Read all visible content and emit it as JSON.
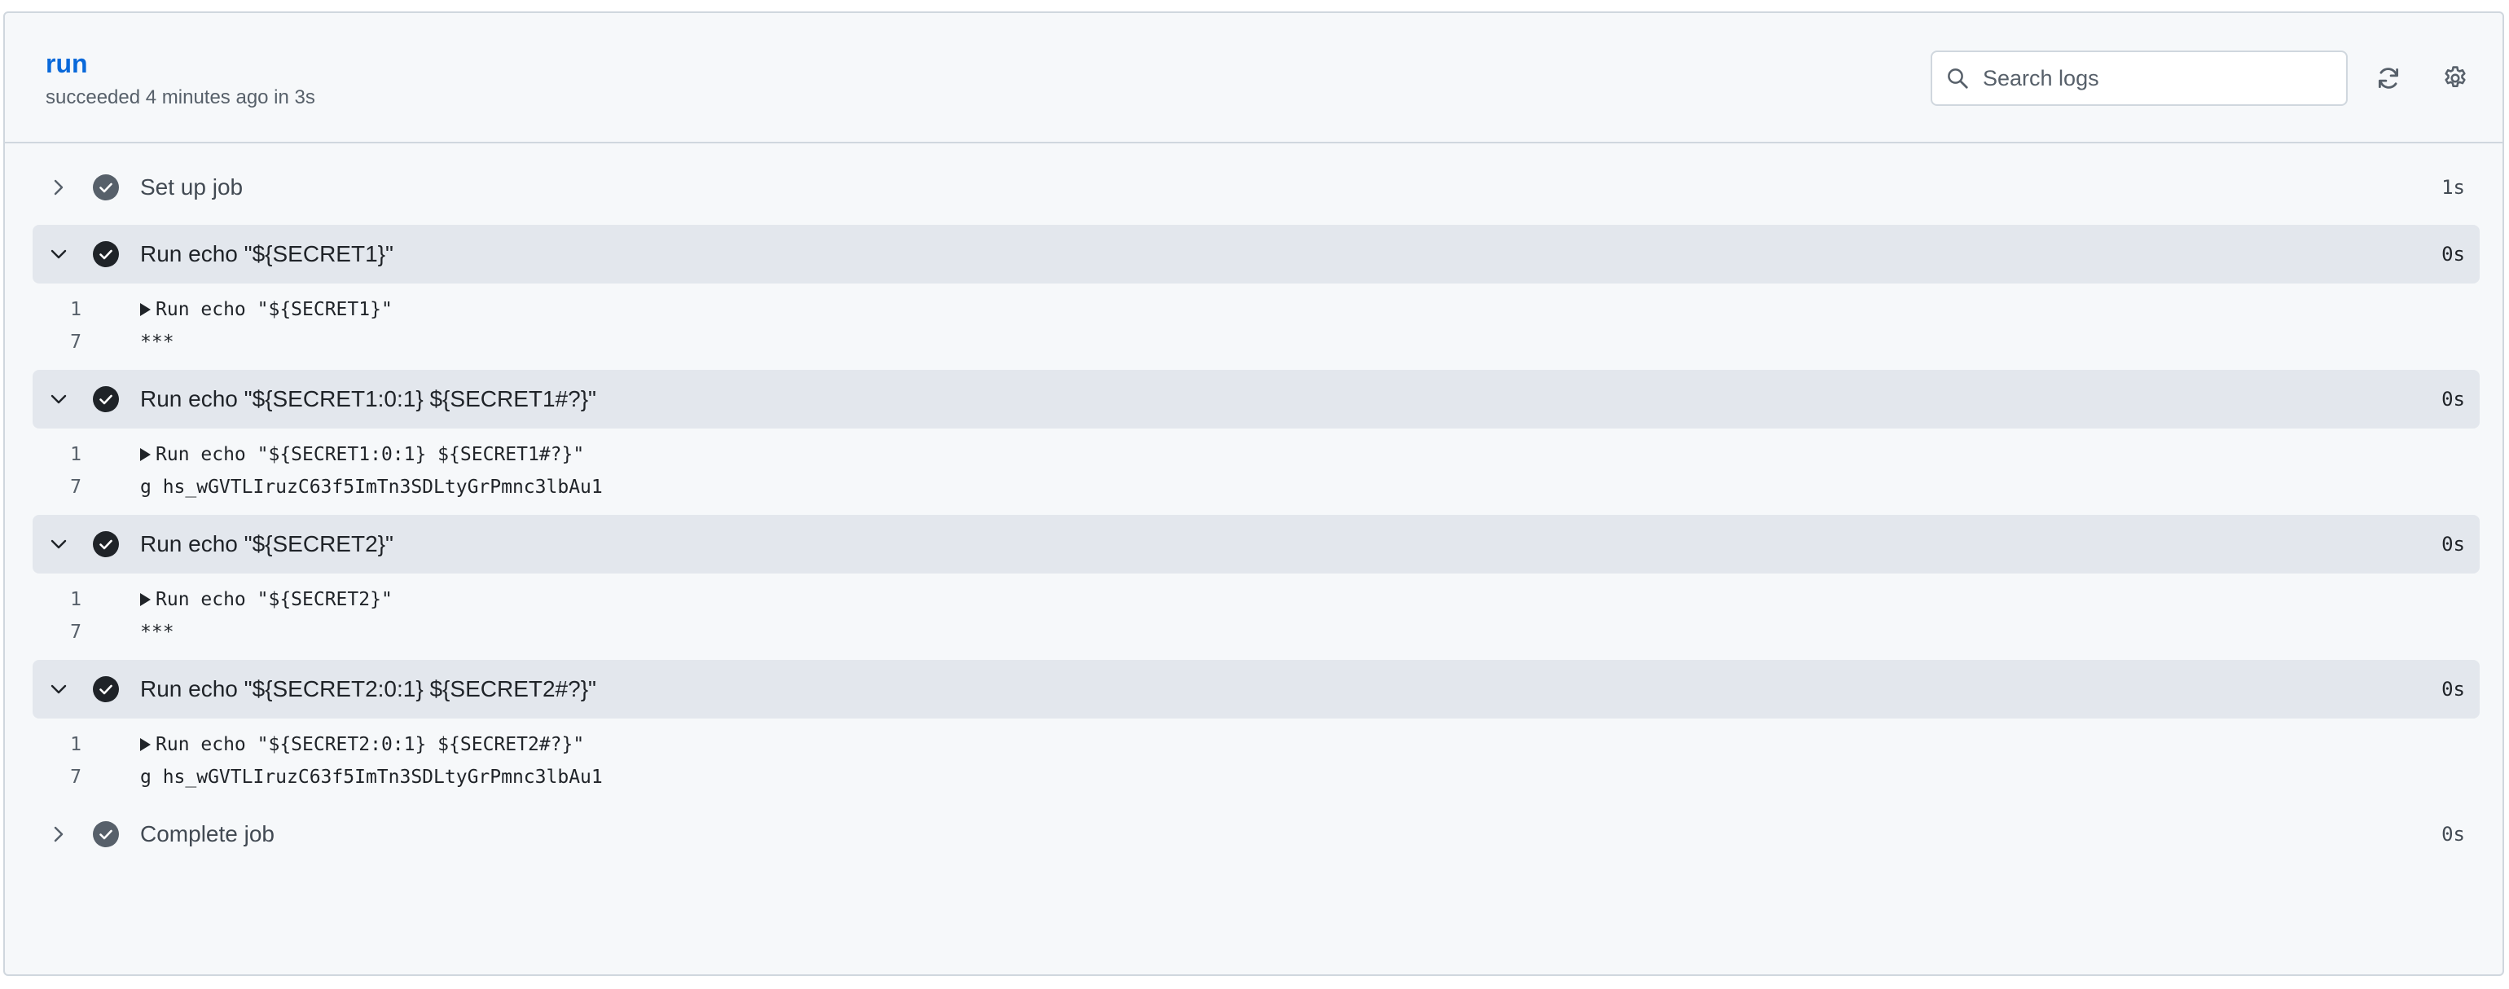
{
  "header": {
    "title": "run",
    "status": "succeeded 4 minutes ago in 3s",
    "search_placeholder": "Search logs"
  },
  "steps": [
    {
      "name": "Set up job",
      "duration": "1s",
      "expanded": false,
      "lines": []
    },
    {
      "name": "Run echo \"${SECRET1}\"",
      "duration": "0s",
      "expanded": true,
      "lines": [
        {
          "num": "1",
          "text": "Run echo \"${SECRET1}\"",
          "group": true
        },
        {
          "num": "7",
          "text": "***",
          "group": false
        }
      ]
    },
    {
      "name": "Run echo \"${SECRET1:0:1} ${SECRET1#?}\"",
      "duration": "0s",
      "expanded": true,
      "lines": [
        {
          "num": "1",
          "text": "Run echo \"${SECRET1:0:1} ${SECRET1#?}\"",
          "group": true
        },
        {
          "num": "7",
          "text": "g hs_wGVTLIruzC63f5ImTn3SDLtyGrPmnc3lbAu1",
          "group": false
        }
      ]
    },
    {
      "name": "Run echo \"${SECRET2}\"",
      "duration": "0s",
      "expanded": true,
      "lines": [
        {
          "num": "1",
          "text": "Run echo \"${SECRET2}\"",
          "group": true
        },
        {
          "num": "7",
          "text": "***",
          "group": false
        }
      ]
    },
    {
      "name": "Run echo \"${SECRET2:0:1} ${SECRET2#?}\"",
      "duration": "0s",
      "expanded": true,
      "lines": [
        {
          "num": "1",
          "text": "Run echo \"${SECRET2:0:1} ${SECRET2#?}\"",
          "group": true
        },
        {
          "num": "7",
          "text": "g hs_wGVTLIruzC63f5ImTn3SDLtyGrPmnc3lbAu1",
          "group": false
        }
      ]
    },
    {
      "name": "Complete job",
      "duration": "0s",
      "expanded": false,
      "lines": []
    }
  ],
  "icons": {
    "search": "search-icon",
    "refresh": "refresh-icon",
    "settings": "gear-icon",
    "expand": "chevron-right-icon",
    "collapse": "chevron-down-icon",
    "success": "check-circle-icon"
  },
  "colors": {
    "link": "#0969da",
    "panel_bg": "#f6f8fa",
    "expanded_bg": "#e3e7ed",
    "success_icon_expanded": "#1f2328",
    "success_icon_collapsed": "#57606a"
  }
}
